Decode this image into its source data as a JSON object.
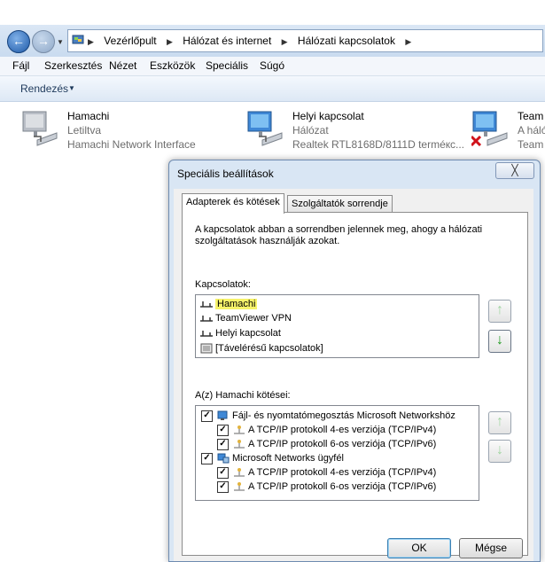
{
  "breadcrumb": [
    "Vezérlőpult",
    "Hálózat és internet",
    "Hálózati kapcsolatok"
  ],
  "menu": [
    "Fájl",
    "Szerkesztés",
    "Nézet",
    "Eszközök",
    "Speciális",
    "Súgó"
  ],
  "toolbar": {
    "organize": "Rendezés"
  },
  "connections": [
    {
      "name": "Hamachi",
      "status": "Letiltva",
      "device": "Hamachi Network Interface"
    },
    {
      "name": "Helyi kapcsolat",
      "status": "Hálózat",
      "device": "Realtek RTL8168D/8111D terméкc..."
    },
    {
      "name": "Team",
      "status": "A háló",
      "device": "Team"
    }
  ],
  "dialog": {
    "title": "Speciális beállítások",
    "close": "╳",
    "tabs": [
      "Adapterek és kötések",
      "Szolgáltatók sorrendje"
    ],
    "description": "A kapcsolatok abban a sorrendben jelennek meg, ahogy a hálózati szolgáltatások használják azokat.",
    "connections_label": "Kapcsolatok:",
    "connection_list": [
      "Hamachi",
      "TeamViewer VPN",
      "Helyi kapcsolat",
      "[Távelérésű kapcsolatok]"
    ],
    "bindings_label": "A(z) Hamachi kötései:",
    "bindings": [
      {
        "label": "Fájl- és nyomtatómegosztás Microsoft Networkshöz",
        "checked": true,
        "level": 0
      },
      {
        "label": "A TCP/IP protokoll 4-es verziója (TCP/IPv4)",
        "checked": true,
        "level": 1
      },
      {
        "label": "A TCP/IP protokoll 6-os verziója (TCP/IPv6)",
        "checked": true,
        "level": 1
      },
      {
        "label": "Microsoft Networks ügyfél",
        "checked": true,
        "level": 0
      },
      {
        "label": "A TCP/IP protokoll 4-es verziója (TCP/IPv4)",
        "checked": true,
        "level": 1
      },
      {
        "label": "A TCP/IP protokoll 6-os verziója (TCP/IPv6)",
        "checked": true,
        "level": 1
      }
    ],
    "ok": "OK",
    "cancel": "Mégse"
  }
}
